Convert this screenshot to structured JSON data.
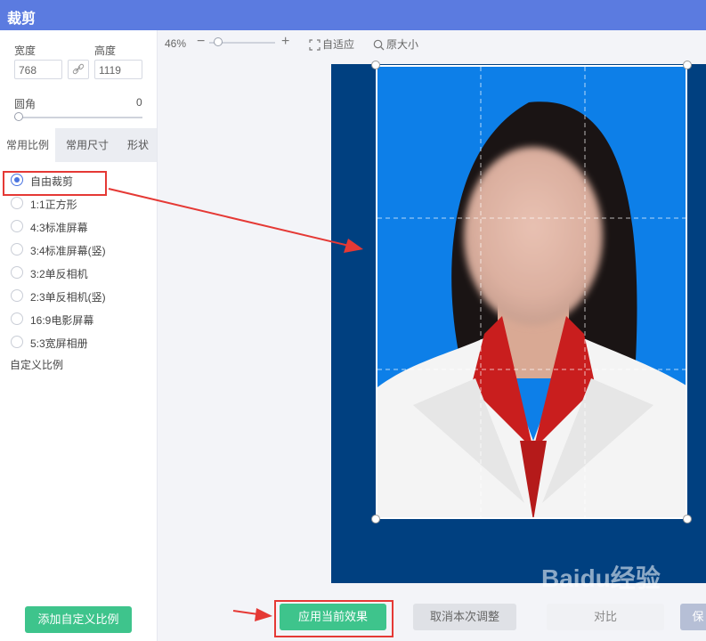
{
  "window": {
    "title": "裁剪"
  },
  "size": {
    "width_label": "宽度",
    "width_value": "768",
    "height_label": "高度",
    "height_value": "1119"
  },
  "corner": {
    "label": "圆角",
    "value": "0"
  },
  "tabs": [
    {
      "label": "常用比例",
      "active": true
    },
    {
      "label": "常用尺寸",
      "active": false
    },
    {
      "label": "形状",
      "active": false
    }
  ],
  "ratios": [
    {
      "label": "自由裁剪",
      "selected": true
    },
    {
      "label": "1:1正方形",
      "selected": false
    },
    {
      "label": "4:3标准屏幕",
      "selected": false
    },
    {
      "label": "3:4标准屏幕(竖)",
      "selected": false
    },
    {
      "label": "3:2单反相机",
      "selected": false
    },
    {
      "label": "2:3单反相机(竖)",
      "selected": false
    },
    {
      "label": "16:9电影屏幕",
      "selected": false
    },
    {
      "label": "5:3宽屏相册",
      "selected": false
    }
  ],
  "custom": {
    "title": "自定义比例",
    "add_button": "添加自定义比例"
  },
  "zoom": {
    "percent": "46%",
    "fit_label": "自适应",
    "original_label": "原大小",
    "level_fraction": 0.1
  },
  "actions": {
    "apply": "应用当前效果",
    "cancel": "取消本次调整",
    "compare": "对比",
    "more": "保"
  },
  "watermark": "Baidu经验",
  "colors": {
    "titlebar": "#5b7be0",
    "accent_green": "#3ec48c",
    "highlight_red": "#e53935",
    "photo_bg_dark": "#004080",
    "photo_bg_blue": "#0d7fe8",
    "radio_selected": "#4a74e0"
  },
  "icons": [
    "link-icon",
    "fit-screen-icon",
    "magnifier-icon",
    "radio-selected-icon",
    "radio-empty-icon",
    "arrow-icon"
  ]
}
